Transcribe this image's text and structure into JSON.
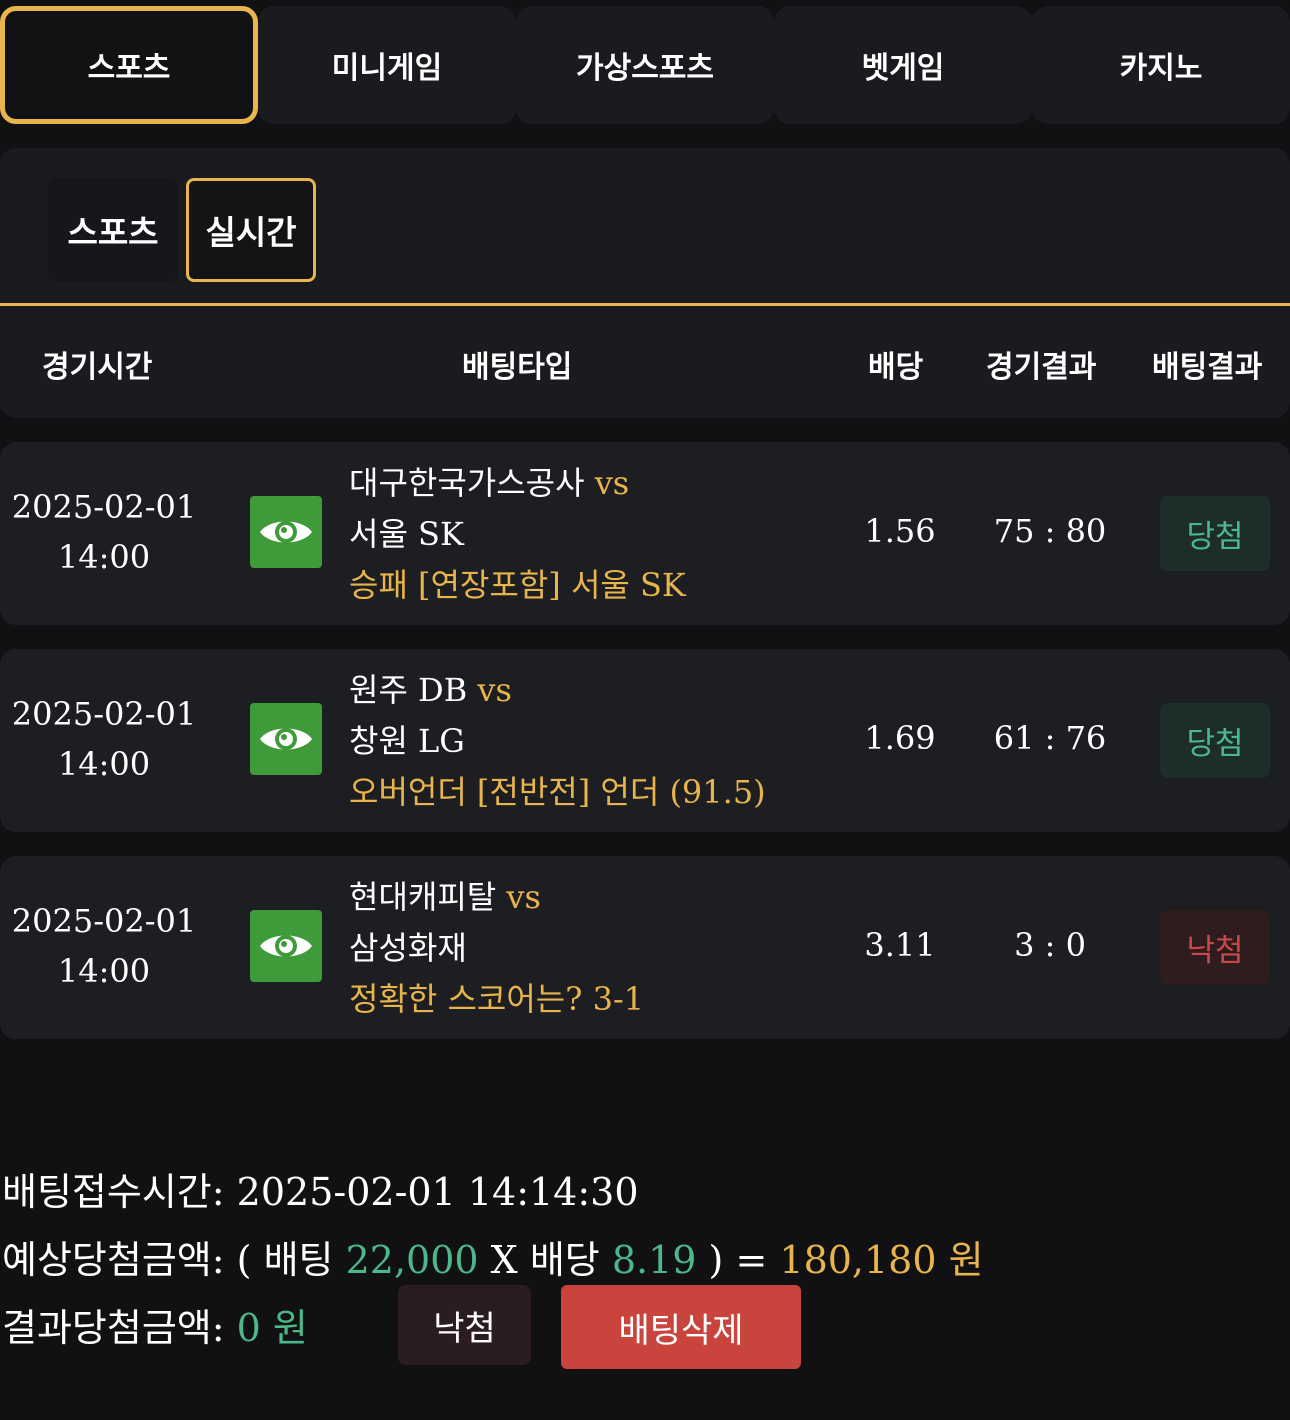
{
  "top_tabs": [
    {
      "label": "스포츠",
      "active": true
    },
    {
      "label": "미니게임",
      "active": false
    },
    {
      "label": "가상스포츠",
      "active": false
    },
    {
      "label": "벳게임",
      "active": false
    },
    {
      "label": "카지노",
      "active": false
    }
  ],
  "sub_tabs": {
    "sports": "스포츠",
    "live": "실시간",
    "active": "live"
  },
  "columns": {
    "time": "경기시간",
    "type": "배팅타입",
    "odds": "배당",
    "result": "경기결과",
    "bet_result": "배팅결과"
  },
  "bets": [
    {
      "date": "2025-02-01",
      "time": "14:00",
      "home": "대구한국가스공사",
      "vs": "vs",
      "away": "서울 SK",
      "pick": "승패 [연장포함] 서울 SK",
      "odds": "1.56",
      "score": "75 : 80",
      "result": "당첨",
      "result_type": "win"
    },
    {
      "date": "2025-02-01",
      "time": "14:00",
      "home": "원주 DB",
      "vs": "vs",
      "away": "창원 LG",
      "pick": "오버언더 [전반전] 언더 (91.5)",
      "odds": "1.69",
      "score": "61 : 76",
      "result": "당첨",
      "result_type": "win"
    },
    {
      "date": "2025-02-01",
      "time": "14:00",
      "home": "현대캐피탈",
      "vs": "vs",
      "away": "삼성화재",
      "pick": "정확한 스코어는? 3-1",
      "odds": "3.11",
      "score": "3 : 0",
      "result": "낙첨",
      "result_type": "lose"
    }
  ],
  "summary": {
    "bet_time_label": "배팅접수시간:",
    "bet_time": "2025-02-01 14:14:30",
    "expected_label": "예상당첨금액:",
    "open_paren": "(",
    "bet_word": "배팅",
    "bet_amount": "22,000",
    "x": "X",
    "odds_word": "배당",
    "total_odds": "8.19",
    "close_eq": ") =",
    "expected_amount": "180,180 원",
    "result_label": "결과당첨금액:",
    "result_amount": "0 원",
    "status_button": "낙첨",
    "delete_button": "배팅삭제"
  },
  "colors": {
    "accent_gold": "#e8b44c",
    "win_green": "#4cb88a",
    "lose_red": "#c9484a",
    "eye_green": "#3f9a3a",
    "delete_red": "#c9443c"
  },
  "icons": {
    "eye": "eye-icon"
  }
}
